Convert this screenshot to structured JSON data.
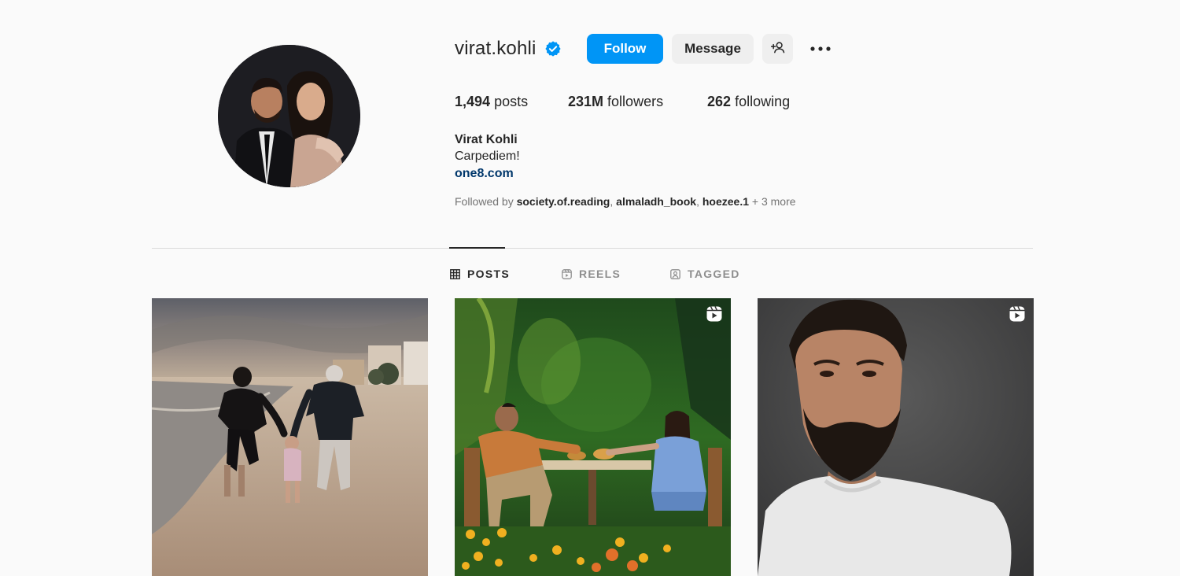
{
  "profile": {
    "username": "virat.kohli",
    "verified": true,
    "follow_label": "Follow",
    "message_label": "Message",
    "suggest_icon": "add-person-icon",
    "more_icon": "more-options-icon"
  },
  "stats": {
    "posts_count": "1,494",
    "posts_label": "posts",
    "followers_count": "231M",
    "followers_label": "followers",
    "following_count": "262",
    "following_label": "following"
  },
  "bio": {
    "name": "Virat Kohli",
    "text": "Carpediem!",
    "link": "one8.com",
    "followed_by_prefix": "Followed by",
    "followed_by_accounts": [
      "society.of.reading",
      "almaladh_book",
      "hoezee.1"
    ],
    "followed_by_sep": ",",
    "followed_by_more": "+ 3 more"
  },
  "tabs": [
    {
      "label": "POSTS",
      "icon": "grid-icon",
      "active": true
    },
    {
      "label": "REELS",
      "icon": "reels-icon",
      "active": false
    },
    {
      "label": "TAGGED",
      "icon": "tagged-icon",
      "active": false
    }
  ],
  "posts": [
    {
      "kind": "photo",
      "is_reel": false
    },
    {
      "kind": "reel",
      "is_reel": true
    },
    {
      "kind": "reel",
      "is_reel": true
    }
  ],
  "colors": {
    "accent": "#0095f6",
    "link": "#00376b",
    "verified": "#0095f6",
    "background": "#fafafa"
  }
}
